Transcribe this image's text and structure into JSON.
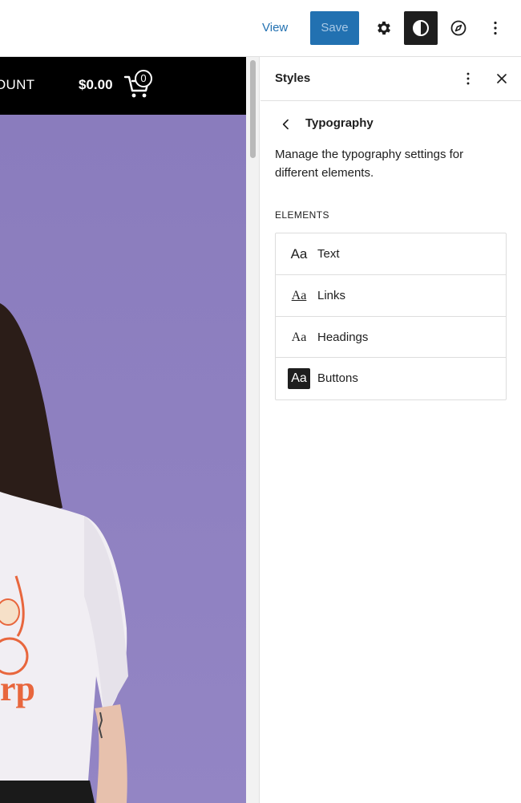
{
  "toolbar": {
    "view_label": "View",
    "save_label": "Save",
    "icons": [
      "gear-icon",
      "contrast-icon",
      "compass-icon",
      "more-vertical-icon"
    ]
  },
  "canvas": {
    "account_text": "OUNT",
    "cart_total": "$0.00",
    "cart_count": "0",
    "shirt_text": "rp",
    "colors": {
      "background": "#8e7fbf",
      "header": "#000000",
      "shirt": "#f1eef3",
      "brand": "#e8663d"
    }
  },
  "sidebar": {
    "title": "Styles",
    "nav_title": "Typography",
    "description": "Manage the typography settings for different elements.",
    "section_label": "ELEMENTS",
    "elements": [
      {
        "preview": "Aa",
        "label": "Text"
      },
      {
        "preview": "Aa",
        "label": "Links"
      },
      {
        "preview": "Aa",
        "label": "Headings"
      },
      {
        "preview": "Aa",
        "label": "Buttons"
      }
    ]
  },
  "colors": {
    "accent": "#2271b1",
    "dark": "#1e1e1e",
    "border": "#dddddd"
  }
}
